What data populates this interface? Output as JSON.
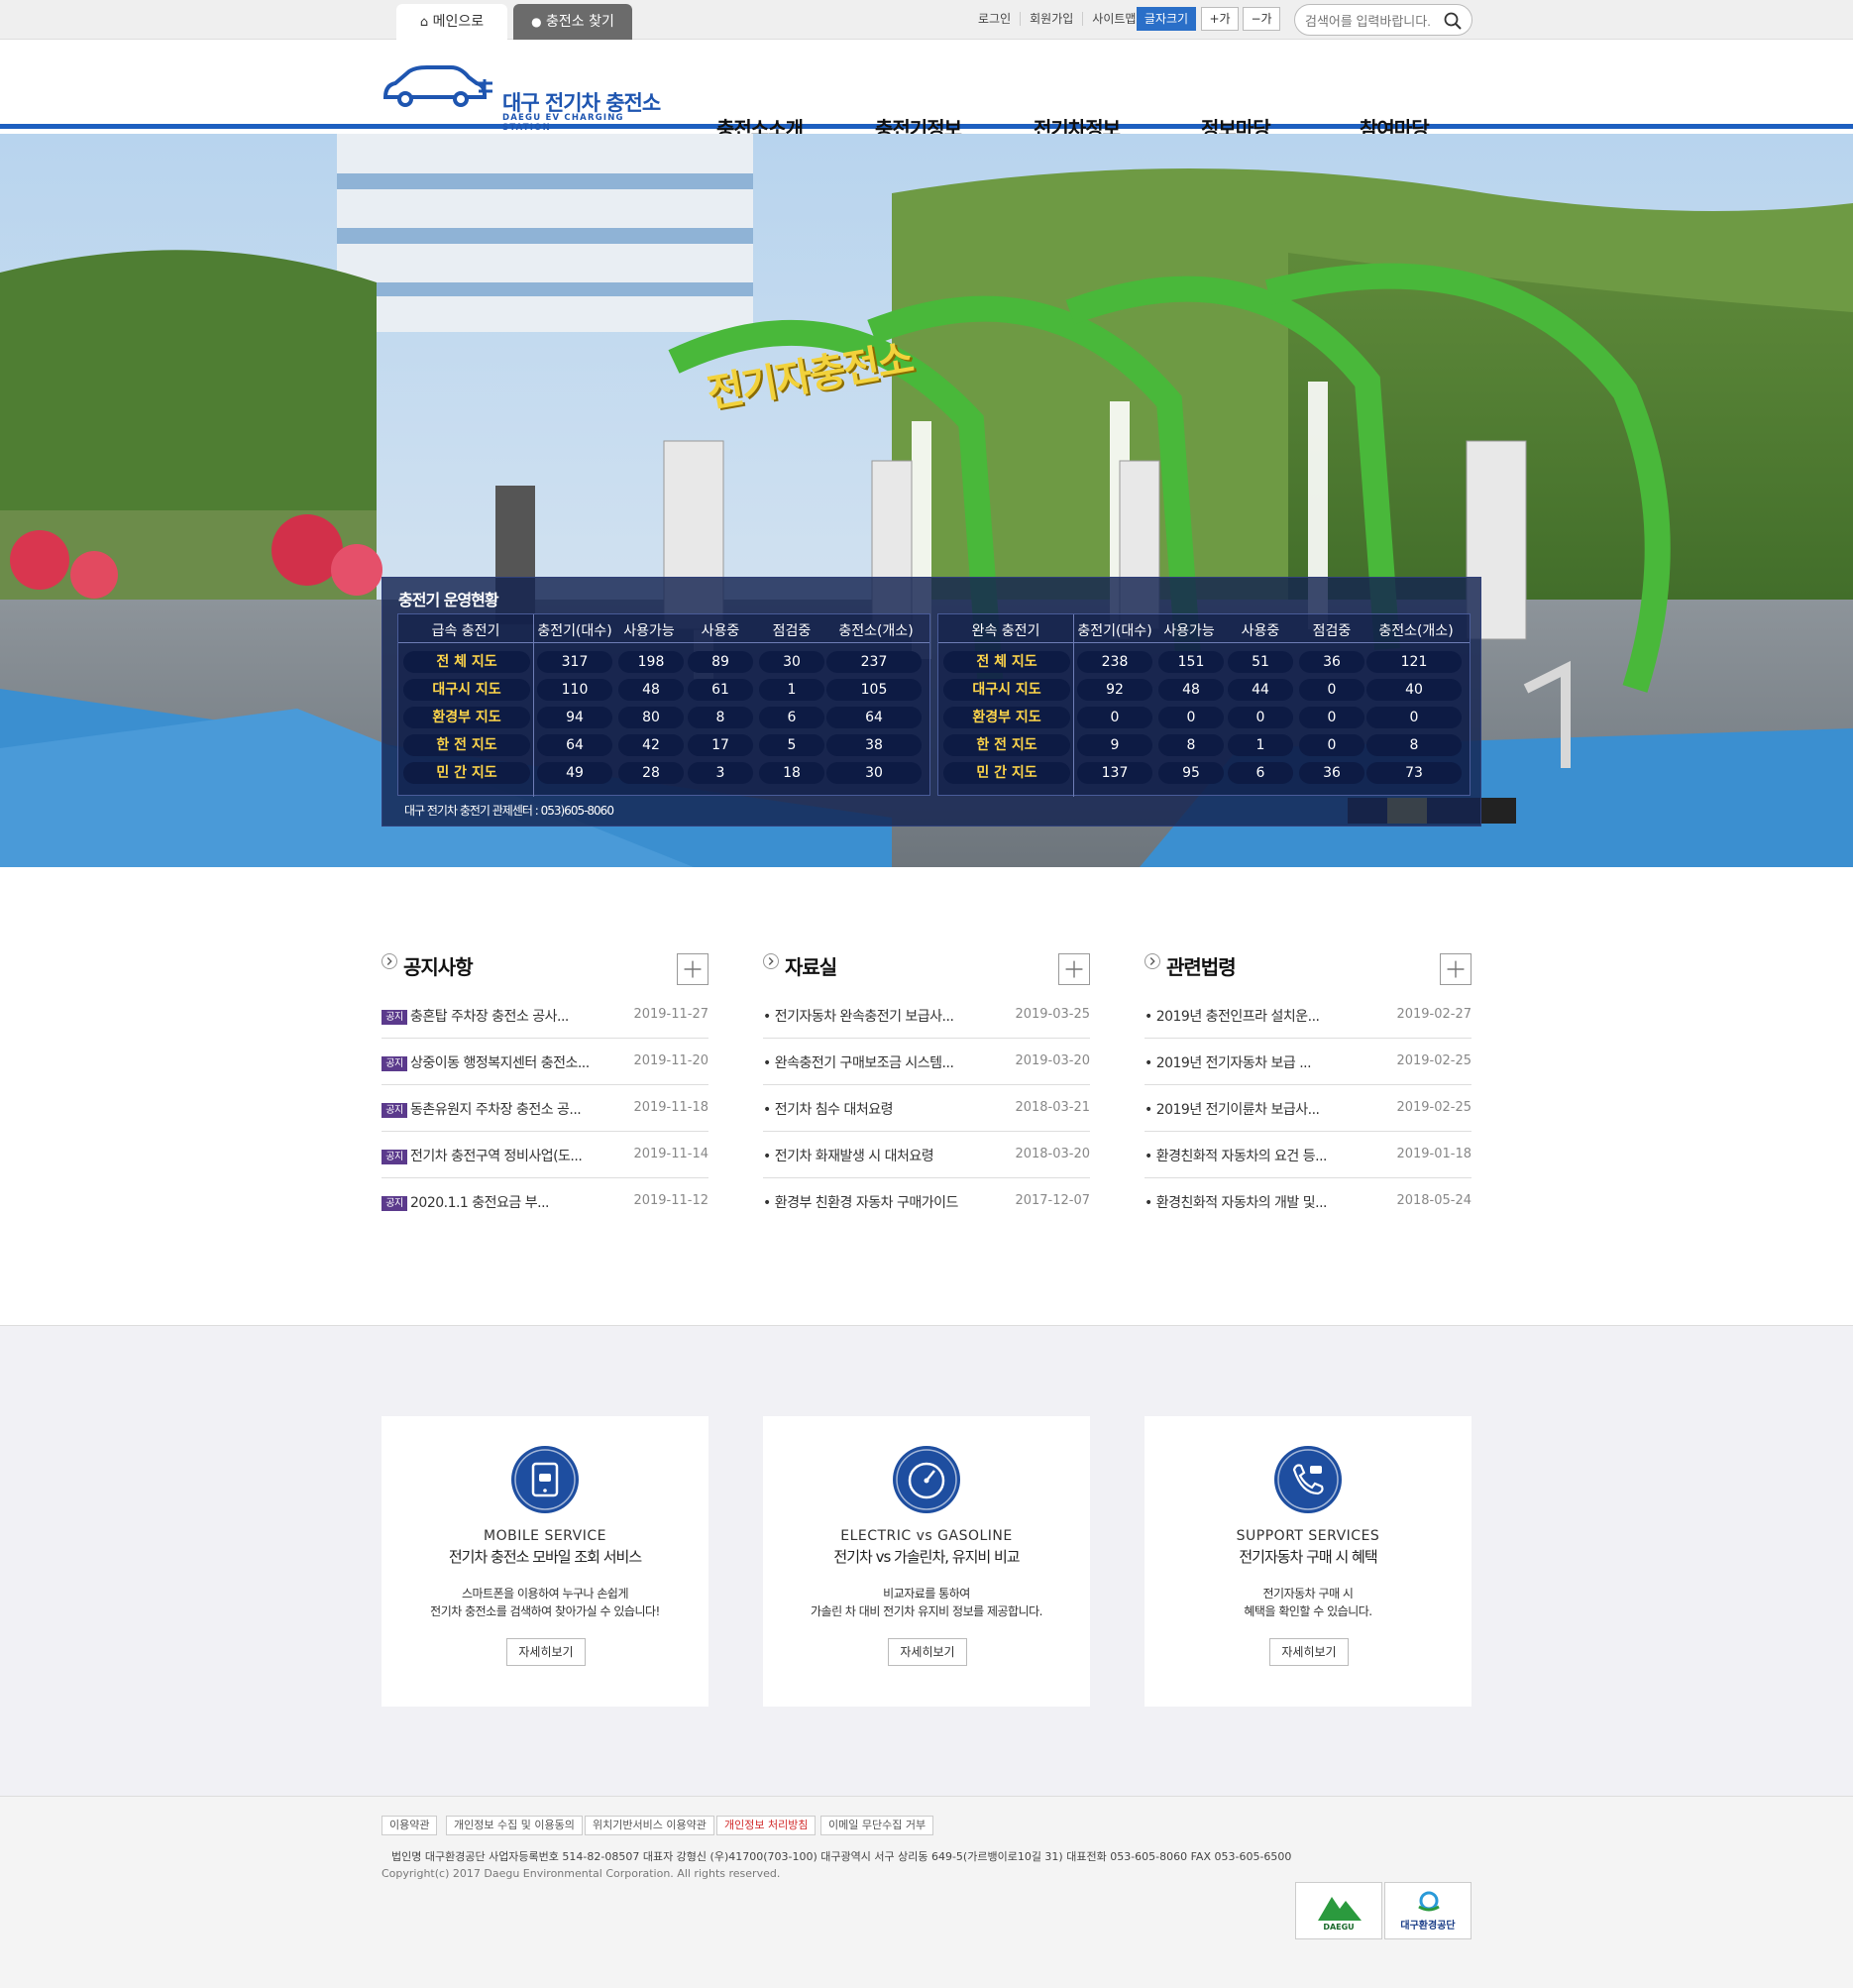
{
  "topbar": {
    "home_tab": "메인으로",
    "find_tab": "충전소 찾기",
    "links": [
      "로그인",
      "회원가입",
      "사이트맵"
    ],
    "font_size": "글자크기",
    "font_plus": "+가",
    "font_minus": "−가",
    "search_placeholder": "검색어를 입력바랍니다."
  },
  "header": {
    "logo_text": "대구 전기차 충전소",
    "logo_sub": "DAEGU EV CHARGING STATION",
    "nav": [
      "충전소소개",
      "충전기정보",
      "전기차정보",
      "정보마당",
      "참여마당"
    ]
  },
  "hero": {
    "sign": "전기자충전소"
  },
  "status": {
    "title": "충전기 운영현황",
    "footer": "대구 전기차 충전기 관제센터 : 053)605-8060",
    "fast": {
      "headers": [
        "급속 충전기",
        "충전기(대수)",
        "사용가능",
        "사용중",
        "점검중",
        "충전소(개소)"
      ],
      "rows": [
        [
          "전 체 지도",
          "317",
          "198",
          "89",
          "30",
          "237"
        ],
        [
          "대구시 지도",
          "110",
          "48",
          "61",
          "1",
          "105"
        ],
        [
          "환경부 지도",
          "94",
          "80",
          "8",
          "6",
          "64"
        ],
        [
          "한 전 지도",
          "64",
          "42",
          "17",
          "5",
          "38"
        ],
        [
          "민 간 지도",
          "49",
          "28",
          "3",
          "18",
          "30"
        ]
      ]
    },
    "slow": {
      "headers": [
        "완속 충전기",
        "충전기(대수)",
        "사용가능",
        "사용중",
        "점검중",
        "충전소(개소)"
      ],
      "rows": [
        [
          "전 체 지도",
          "238",
          "151",
          "51",
          "36",
          "121"
        ],
        [
          "대구시 지도",
          "92",
          "48",
          "44",
          "0",
          "40"
        ],
        [
          "환경부 지도",
          "0",
          "0",
          "0",
          "0",
          "0"
        ],
        [
          "한 전 지도",
          "9",
          "8",
          "1",
          "0",
          "8"
        ],
        [
          "민 간 지도",
          "137",
          "95",
          "6",
          "36",
          "73"
        ]
      ]
    }
  },
  "boards": [
    {
      "title": "공지사항",
      "badge": "공지",
      "items": [
        {
          "title": "충혼탑 주차장 충전소 공사...",
          "date": "2019-11-27"
        },
        {
          "title": "상중이동 행정복지센터 충전소...",
          "date": "2019-11-20"
        },
        {
          "title": "동촌유원지 주차장 충전소 공...",
          "date": "2019-11-18"
        },
        {
          "title": "전기차 충전구역 정비사업(도...",
          "date": "2019-11-14"
        },
        {
          "title": "2020.1.1 충전요금 부...",
          "date": "2019-11-12"
        }
      ]
    },
    {
      "title": "자료실",
      "items": [
        {
          "title": "• 전기자동차 완속충전기 보급사...",
          "date": "2019-03-25"
        },
        {
          "title": "• 완속충전기 구매보조금 시스템...",
          "date": "2019-03-20"
        },
        {
          "title": "• 전기차 침수 대처요령",
          "date": "2018-03-21"
        },
        {
          "title": "• 전기차 화재발생 시 대처요령",
          "date": "2018-03-20"
        },
        {
          "title": "• 환경부 친환경 자동차 구매가이드",
          "date": "2017-12-07"
        }
      ]
    },
    {
      "title": "관련법령",
      "items": [
        {
          "title": "• 2019년 충전인프라 설치운...",
          "date": "2019-02-27"
        },
        {
          "title": "• 2019년 전기자동차 보급 ...",
          "date": "2019-02-25"
        },
        {
          "title": "• 2019년 전기이륜차 보급사...",
          "date": "2019-02-25"
        },
        {
          "title": "• 환경친화적 자동차의 요건 등...",
          "date": "2019-01-18"
        },
        {
          "title": "• 환경친화적 자동차의 개발 및...",
          "date": "2018-05-24"
        }
      ]
    }
  ],
  "services": [
    {
      "en": "MOBILE SERVICE",
      "ko": "전기차 충전소 모바일 조회 서비스",
      "desc1": "스마트폰을 이용하여 누구나 손쉽게",
      "desc2": "전기차 충전소를 검색하여 찾아가실 수 있습니다!",
      "button": "자세히보기",
      "icon": "mobile-car-icon"
    },
    {
      "en": "ELECTRIC vs GASOLINE",
      "ko": "전기차 vs 가솔린차, 유지비 비교",
      "desc1": "비교자료를 통하여",
      "desc2": "가솔린 차 대비 전기차 유지비 정보를 제공합니다.",
      "button": "자세히보기",
      "icon": "gauge-icon"
    },
    {
      "en": "SUPPORT SERVICES",
      "ko": "전기자동차 구매 시 혜택",
      "desc1": "전기자동차 구매 시",
      "desc2": "혜택을 확인할 수 있습니다.",
      "button": "자세히보기",
      "icon": "support-phone-icon"
    }
  ],
  "footer": {
    "links": [
      "이용약관",
      "개인정보 수집 및 이용동의",
      "위치기반서비스 이용약관",
      "개인정보 처리방침",
      "이메일 무단수집 거부"
    ],
    "address": "법인명  대구환경공단    사업자등록번호  514-82-08507    대표자  강형신    (우)41700(703-100) 대구광역시 서구 상리동 649-5(가르뱅이로10길 31)    대표전화  053-605-8060    FAX  053-605-6500",
    "copyright": "Copyright(c) 2017 Daegu Environmental Corporation. All rights reserved.",
    "logo1": "DAEGU",
    "logo2": "대구환경공단"
  },
  "colors": {
    "brand_blue": "#1d5fc0",
    "status_panel": "#14234f",
    "label_yellow": "#ffd64a",
    "badge_purple": "#5b3a8c",
    "privacy_red": "#d12a2a"
  }
}
